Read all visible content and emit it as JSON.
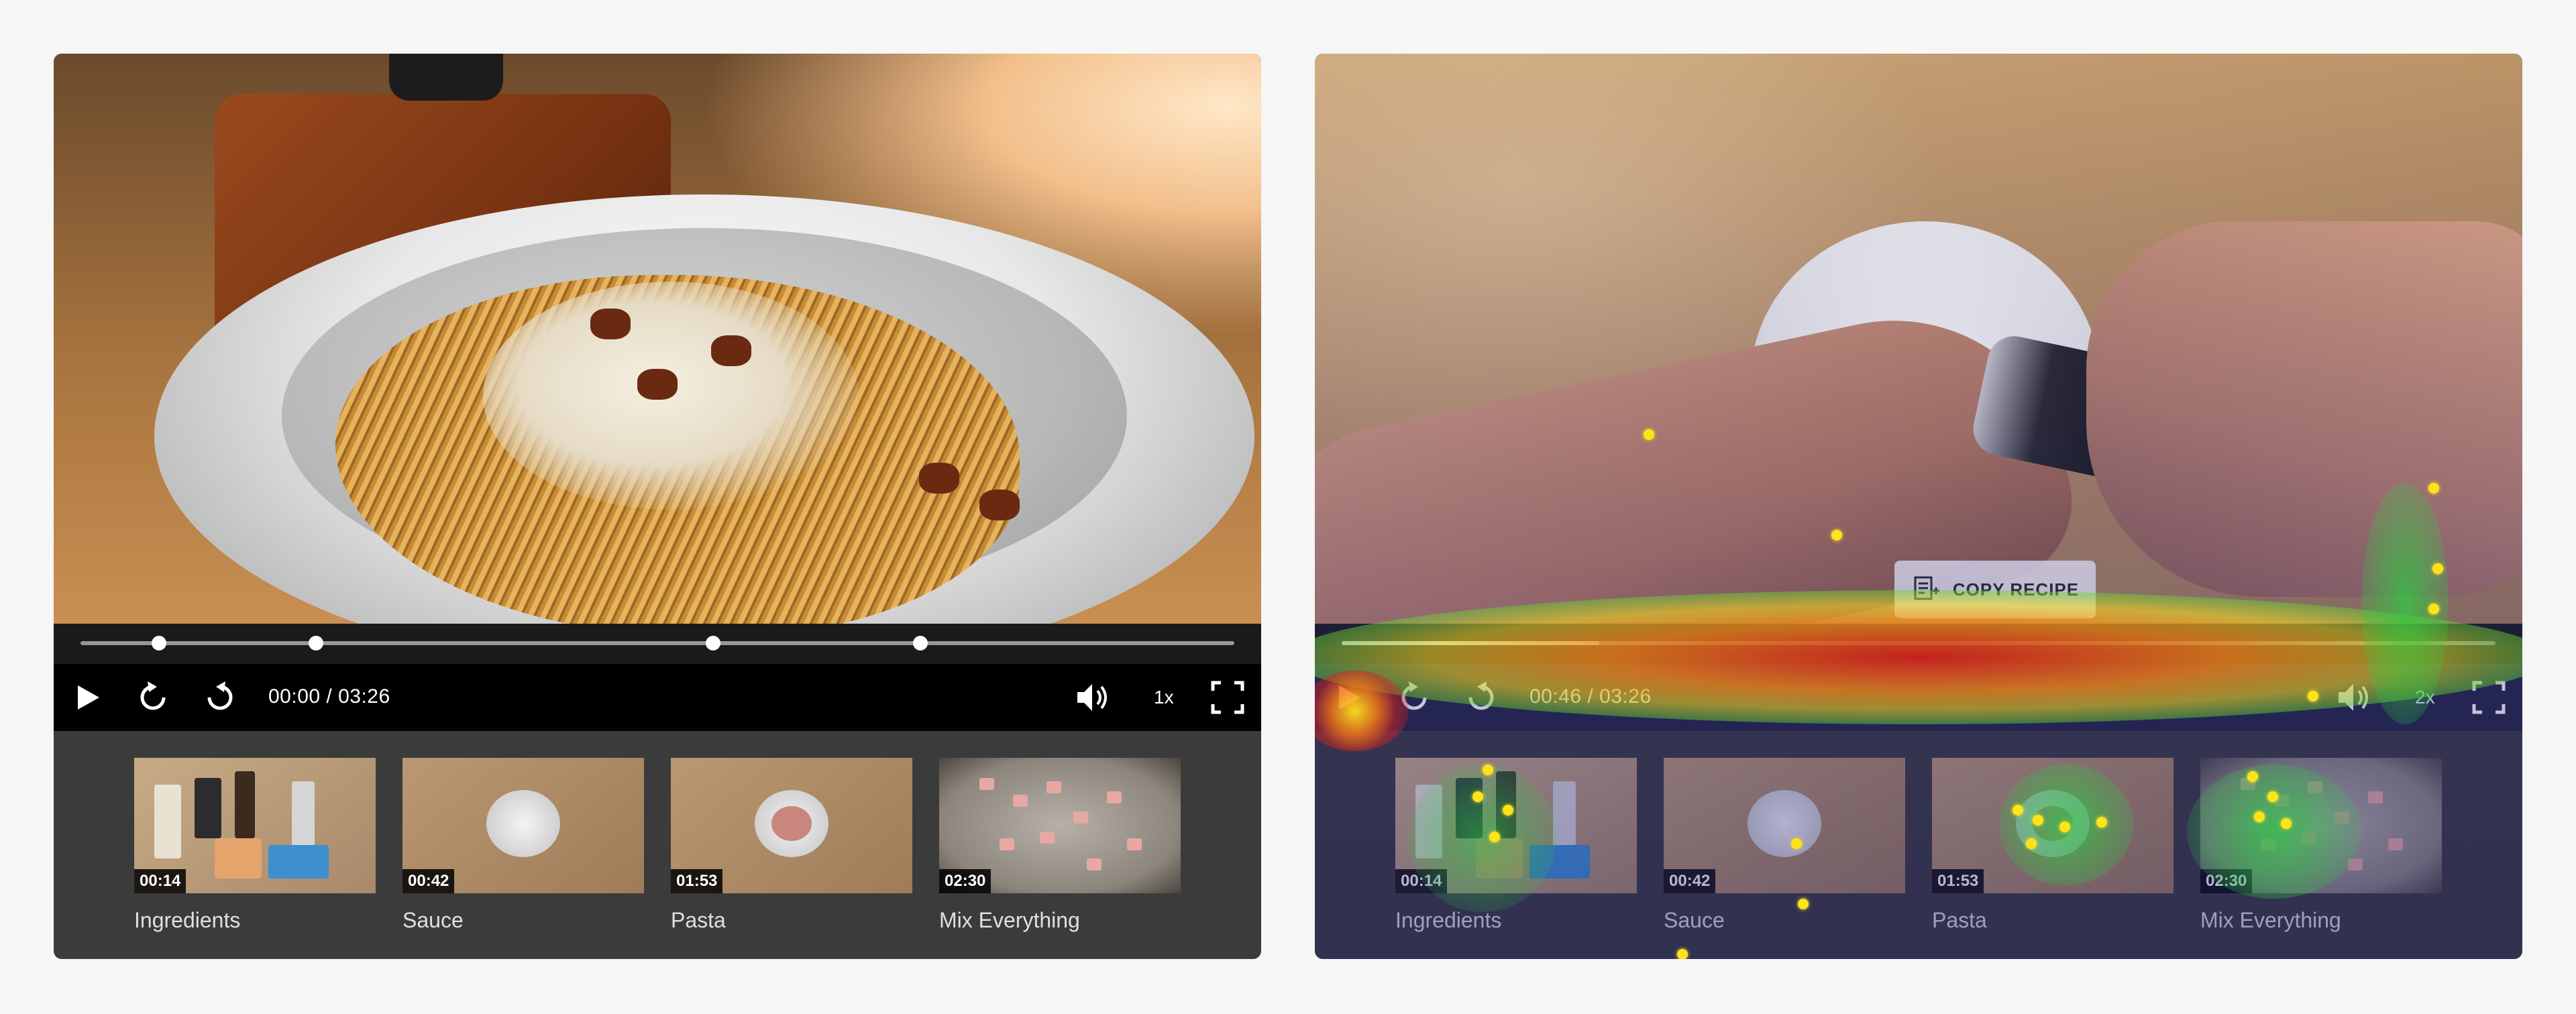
{
  "panels": [
    {
      "id": "original",
      "time": "00:00 / 03:26",
      "speed": "1x",
      "progress": 0.0,
      "chapters": [
        {
          "time": "00:14",
          "label": "Ingredients"
        },
        {
          "time": "00:42",
          "label": "Sauce"
        },
        {
          "time": "01:53",
          "label": "Pasta"
        },
        {
          "time": "02:30",
          "label": "Mix Everything"
        }
      ]
    },
    {
      "id": "heatmap",
      "time": "00:46 / 03:26",
      "speed": "2x",
      "progress": 0.223,
      "copy_recipe": "COPY RECIPE",
      "chapters": [
        {
          "time": "00:14",
          "label": "Ingredients"
        },
        {
          "time": "00:42",
          "label": "Sauce"
        },
        {
          "time": "01:53",
          "label": "Pasta"
        },
        {
          "time": "02:30",
          "label": "Mix Everything"
        }
      ]
    }
  ],
  "chapter_marker_times_sec": [
    14,
    42,
    113,
    150
  ],
  "duration_sec": 206,
  "icons": {
    "play": "play-icon",
    "rewind": "rewind-icon",
    "forward": "forward-icon",
    "volume": "volume-icon",
    "fullscreen": "fullscreen-icon",
    "copy": "copy-recipe-icon"
  },
  "colors": {
    "controls_bg": "#000000",
    "chapters_bg": "#3b3b3b",
    "heat_hot": "#e0231b",
    "heat_mid": "#ffe31a",
    "heat_cool": "#2ecc40"
  }
}
